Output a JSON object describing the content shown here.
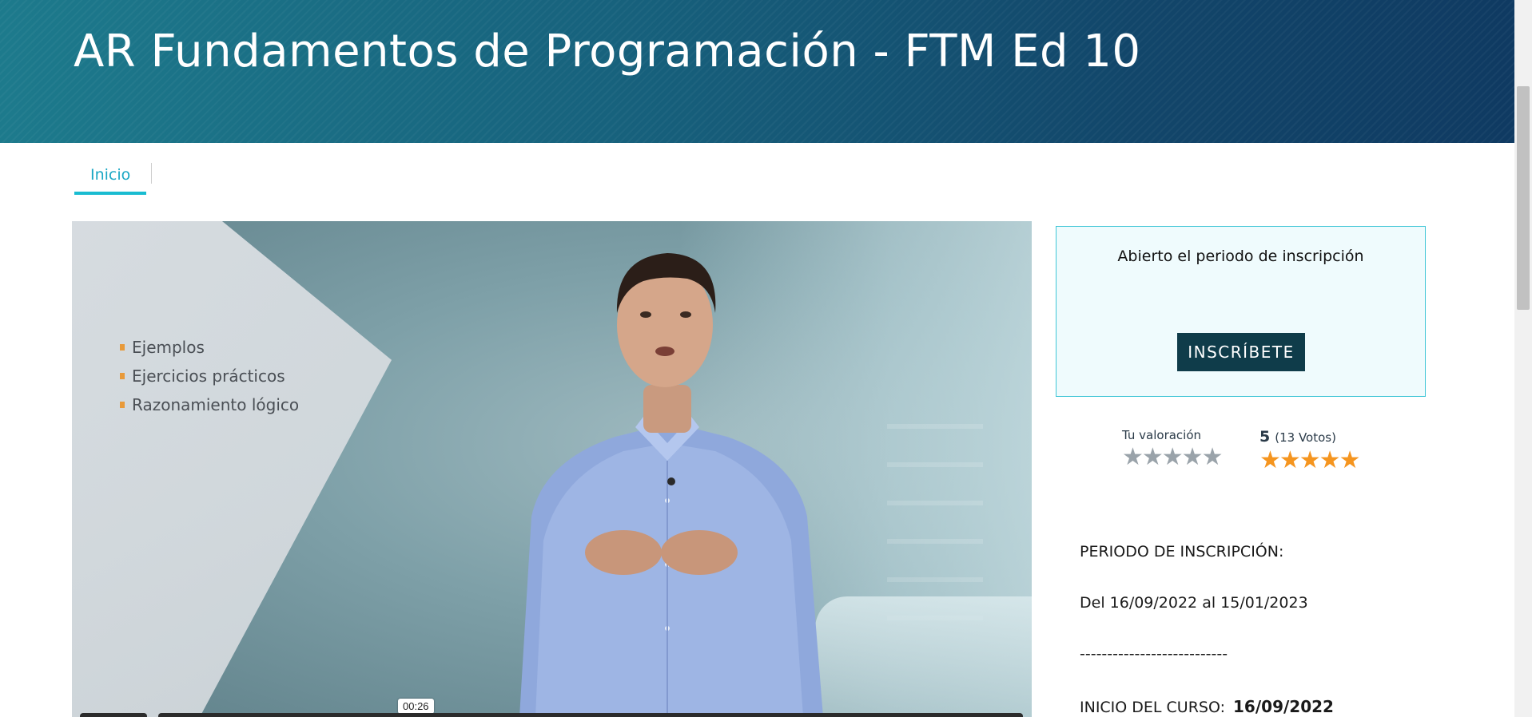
{
  "header": {
    "title": "AR Fundamentos de Programación - FTM Ed 10"
  },
  "tabs": [
    {
      "label": "Inicio",
      "active": true
    }
  ],
  "video": {
    "bullets": [
      "Ejemplos",
      "Ejercicios prácticos",
      "Razonamiento lógico"
    ],
    "time_tooltip": "00:26"
  },
  "enrollment": {
    "status": "Abierto el periodo de inscripción",
    "button_label": "INSCRÍBETE"
  },
  "ratings": {
    "my_label": "Tu valoración",
    "my_stars": "★★★★★",
    "average_score": "5",
    "votes": "(13 Votos)",
    "average_stars": "★★★★★"
  },
  "info": {
    "period_label": "PERIODO DE INSCRIPCIÓN:",
    "period_dates": "Del 16/09/2022 al 15/01/2023",
    "separator": "---------------------------",
    "start_label": "INICIO DEL CURSO:",
    "start_value": "16/09/2022"
  },
  "colors": {
    "accent": "#19bcd1",
    "button": "#0f3c4a",
    "stars_avg": "#f5951f",
    "stars_empty": "#9aa3aa"
  }
}
